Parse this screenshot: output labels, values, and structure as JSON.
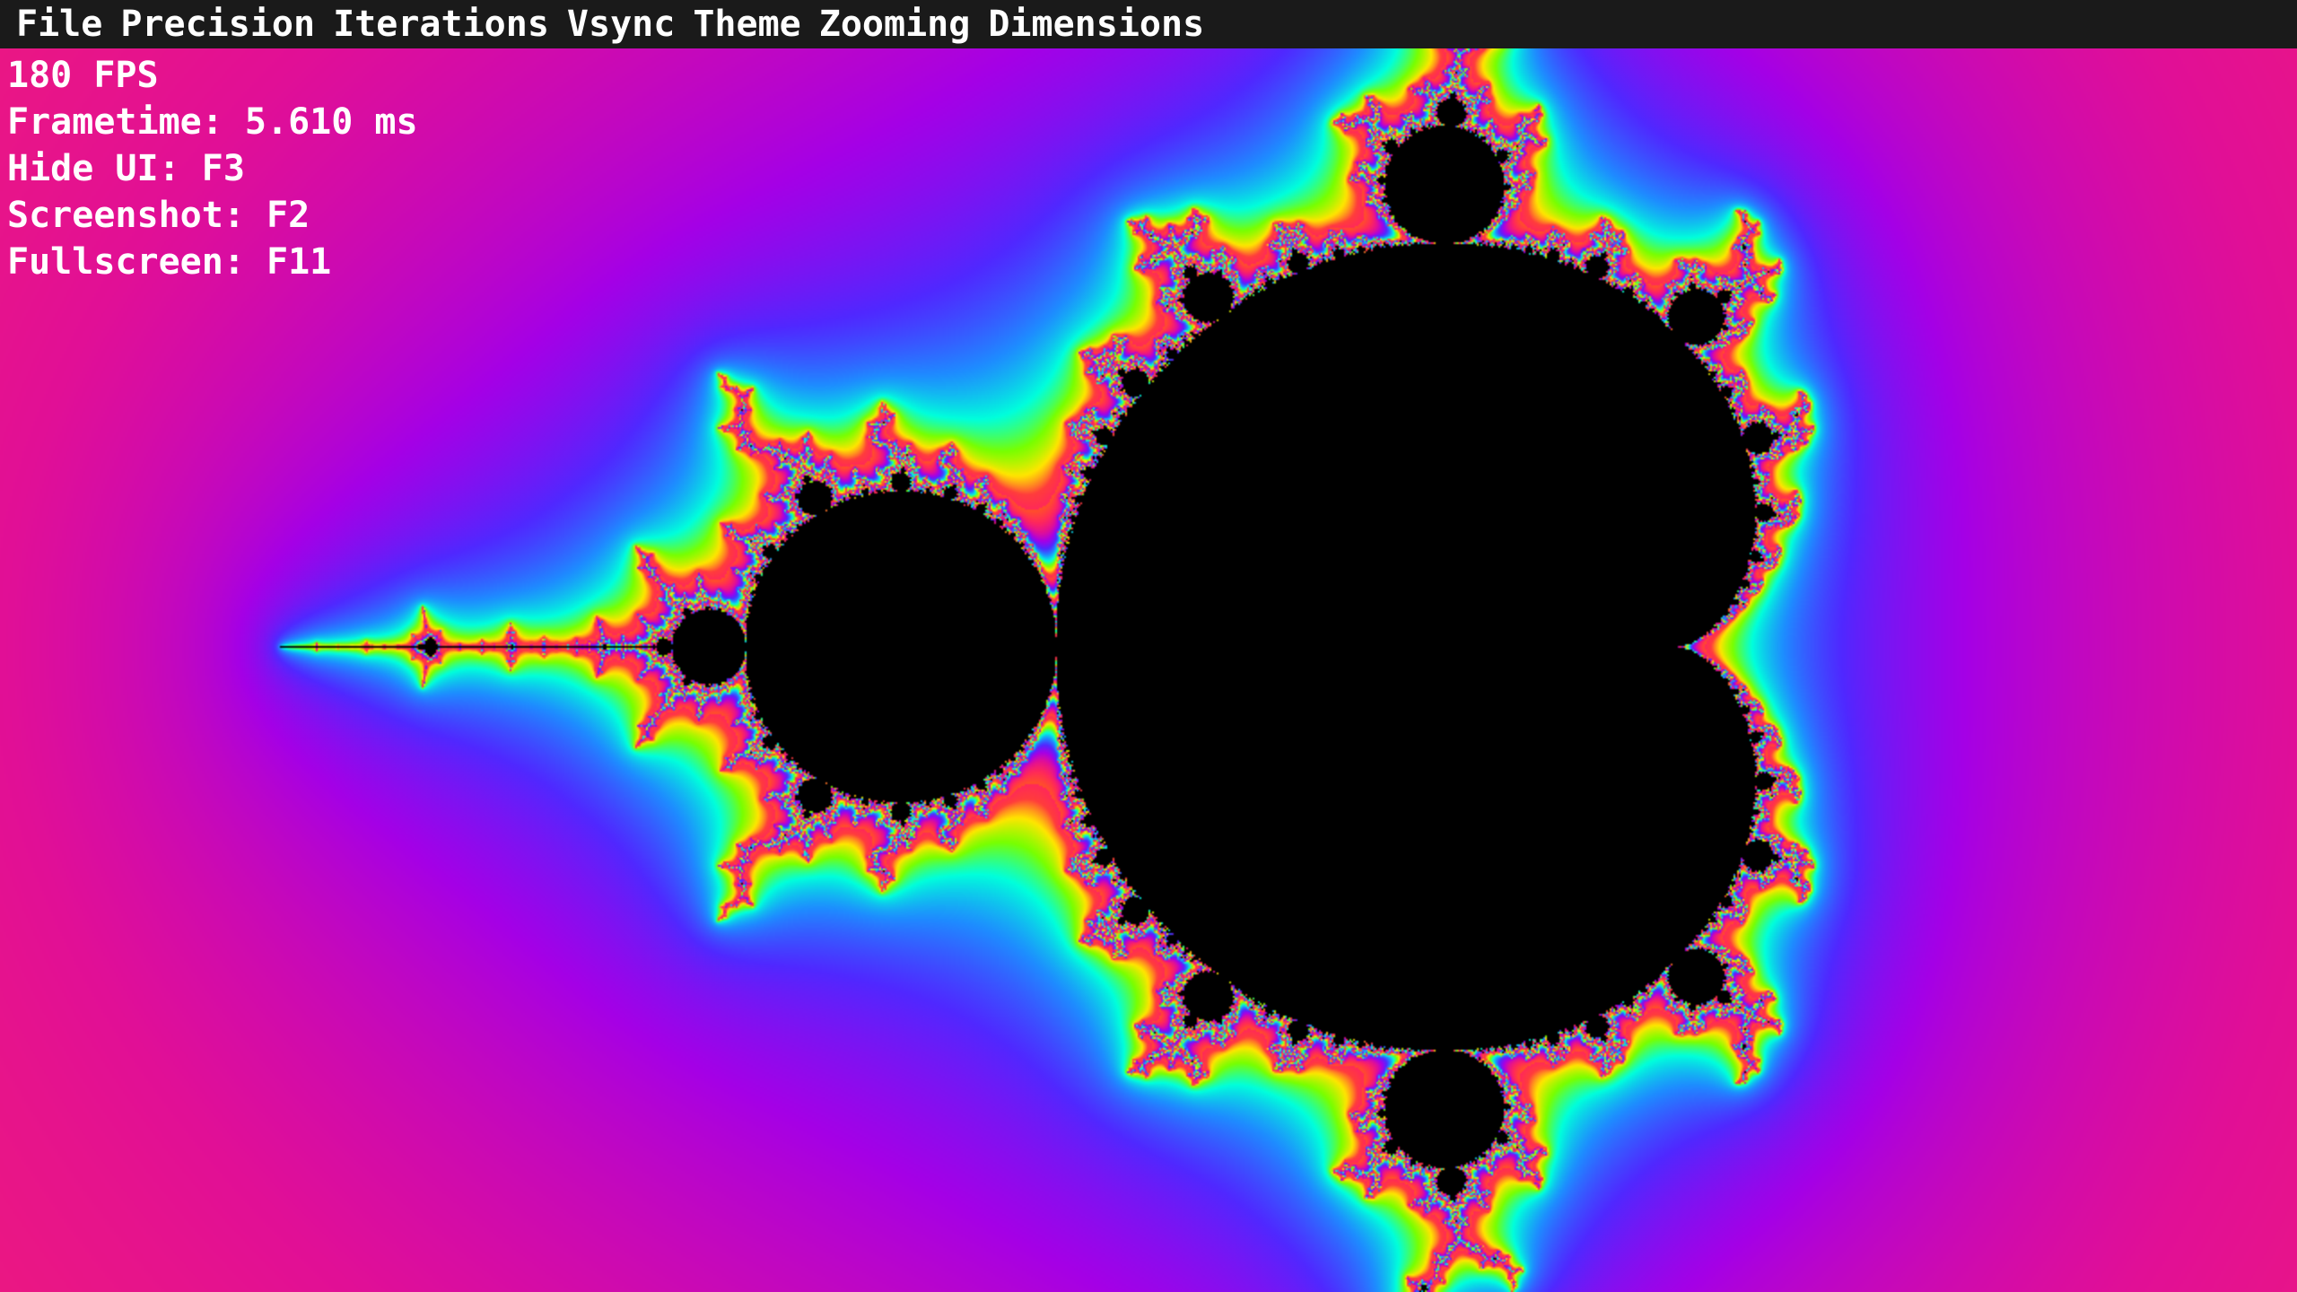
{
  "menu": [
    {
      "label": "File"
    },
    {
      "label": "Precision"
    },
    {
      "label": "Iterations"
    },
    {
      "label": "Vsync"
    },
    {
      "label": "Theme"
    },
    {
      "label": "Zooming"
    },
    {
      "label": "Dimensions"
    }
  ],
  "stats": {
    "fps": "180 FPS",
    "frametime": "Frametime: 5.610 ms",
    "hide_ui": "Hide UI: F3",
    "screenshot": "Screenshot: F2",
    "fullscreen": "Fullscreen: F11"
  },
  "theme": {
    "menubar_bg": "#1a1a1a",
    "text_color": "#ffffff",
    "set_color": "#000000"
  }
}
